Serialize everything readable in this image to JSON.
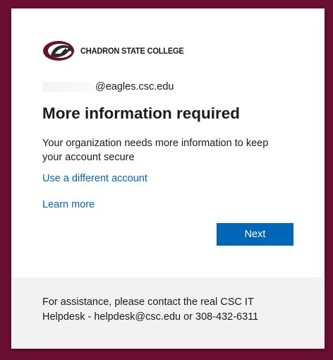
{
  "header": {
    "logo_text": "CHADRON STATE COLLEGE",
    "logo_icon": "eagle-head-logo"
  },
  "identity": {
    "email_suffix": "@eagles.csc.edu"
  },
  "main": {
    "title": "More information required",
    "description": "Your organization needs more information to keep your account secure",
    "use_different_account": "Use a different account",
    "learn_more": "Learn more",
    "next_label": "Next"
  },
  "footer": {
    "text": "For assistance, please contact the real CSC IT Helpdesk - helpdesk@csc.edu or 308-432-6311"
  },
  "colors": {
    "frame": "#6b0f32",
    "accent": "#0067b8",
    "footer_bg": "#f2f2f2"
  }
}
